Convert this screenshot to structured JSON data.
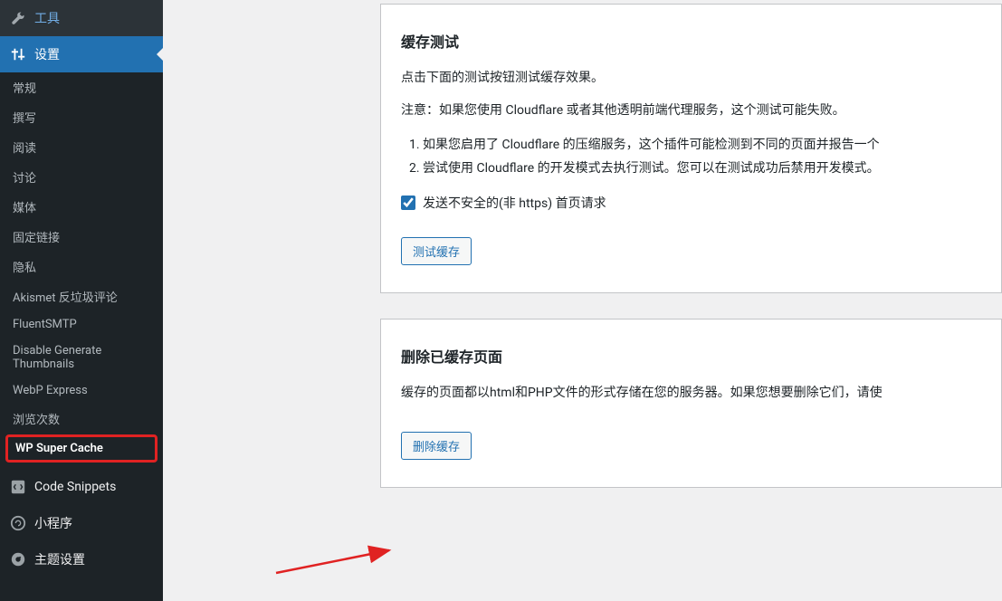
{
  "sidebar": {
    "tools": {
      "label": "工具"
    },
    "settings": {
      "label": "设置"
    },
    "subs": [
      {
        "label": "常规"
      },
      {
        "label": "撰写"
      },
      {
        "label": "阅读"
      },
      {
        "label": "讨论"
      },
      {
        "label": "媒体"
      },
      {
        "label": "固定链接"
      },
      {
        "label": "隐私"
      },
      {
        "label": "Akismet 反垃圾评论"
      },
      {
        "label": "FluentSMTP"
      },
      {
        "label": "Disable Generate Thumbnails"
      },
      {
        "label": "WebP Express"
      },
      {
        "label": "浏览次数"
      },
      {
        "label": "WP Super Cache"
      }
    ],
    "snippets": {
      "label": "Code Snippets"
    },
    "miniprog": {
      "label": "小程序"
    },
    "theme": {
      "label": "主题设置"
    }
  },
  "section1": {
    "title": "缓存测试",
    "p1": "点击下面的测试按钮测试缓存效果。",
    "p2": "注意：如果您使用 Cloudflare 或者其他透明前端代理服务，这个测试可能失败。",
    "li1": "如果您启用了 Cloudflare 的压缩服务，这个插件可能检测到不同的页面并报告一个",
    "li2": "尝试使用 Cloudflare 的开发模式去执行测试。您可以在测试成功后禁用开发模式。",
    "checkbox_label": "发送不安全的(非 https) 首页请求",
    "btn": "测试缓存"
  },
  "section2": {
    "title": "删除已缓存页面",
    "p1": "缓存的页面都以html和PHP文件的形式存储在您的服务器。如果您想要删除它们，请使",
    "btn": "删除缓存"
  }
}
